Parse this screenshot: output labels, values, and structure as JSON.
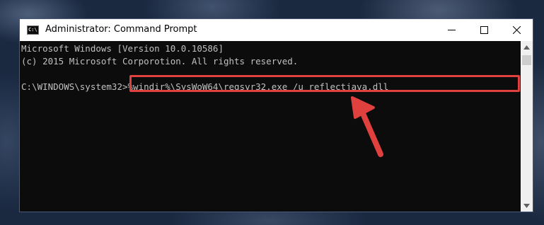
{
  "window": {
    "title": "Administrator: Command Prompt",
    "icon_label": "C:\\"
  },
  "controls": {
    "minimize": "minimize-icon",
    "maximize": "maximize-icon",
    "close": "close-icon"
  },
  "console": {
    "lines": [
      "Microsoft Windows [Version 10.0.10586]",
      "(c) 2015 Microsoft Corporotion. All rights reserved.",
      ""
    ],
    "prompt": "C:\\WINDOWS\\system32>",
    "command": "%windir%\\SysWoW64\\regsvr32.exe /u reflectjava.dll"
  },
  "annotation": {
    "color": "#e0403e"
  }
}
